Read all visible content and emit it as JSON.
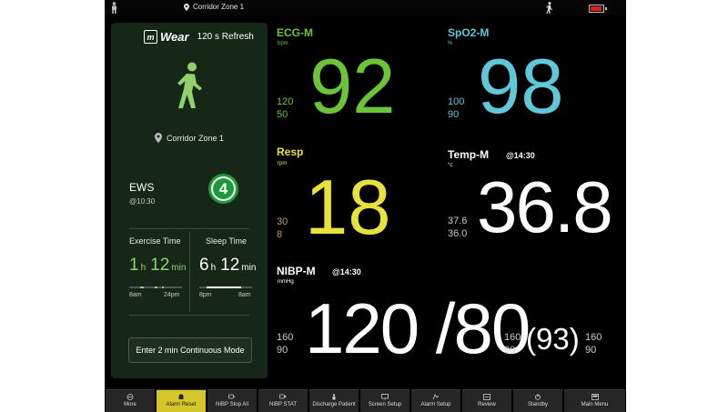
{
  "topbar": {
    "location": "Corridor Zone 1",
    "battery_color": "#e02020"
  },
  "card": {
    "brand": "Wear",
    "brand_logo_letter": "m",
    "refresh": "120 s Refresh",
    "zone": "Corridor Zone 1",
    "ews_label": "EWS",
    "ews_time": "@10:30",
    "ews_score": "4",
    "exercise": {
      "title": "Exercise Time",
      "hours": "1",
      "h": "h",
      "mins": "12",
      "min": "min",
      "tick_start": "8am",
      "tick_end": "24pm"
    },
    "sleep": {
      "title": "Sleep Time",
      "hours": "6",
      "h": "h",
      "mins": "12",
      "min": "min",
      "tick_start": "8pm",
      "tick_end": "8am"
    },
    "continuous_button": "Enter 2 min Continuous Mode"
  },
  "ecg": {
    "label": "ECG-M",
    "unit": "bpm",
    "value": "92",
    "high": "120",
    "low": "50",
    "color": "#6cc43a"
  },
  "spo2": {
    "label": "SpO2-M",
    "unit": "%",
    "value": "98",
    "high": "100",
    "low": "90",
    "color": "#5ec8d8"
  },
  "resp": {
    "label": "Resp",
    "unit": "rpm",
    "value": "18",
    "high": "30",
    "low": "8",
    "color": "#e8e23a"
  },
  "temp": {
    "label": "Temp-M",
    "time": "@14:30",
    "unit": "°c",
    "value": "36.8",
    "high": "37.6",
    "low": "36.0"
  },
  "nibp": {
    "label": "NIBP-M",
    "time": "@14:30",
    "unit": "mmHg",
    "value": "120 /80",
    "sys_high": "160",
    "sys_low": "90",
    "map_high": "160",
    "map_low": "90",
    "map": "(93)",
    "dia_high": "160",
    "dia_low": "90"
  },
  "menu": [
    {
      "label": "More",
      "icon": "more-icon"
    },
    {
      "label": "Alarm Reset",
      "icon": "alarm-reset-icon"
    },
    {
      "label": "NIBP Stop All",
      "icon": "nibp-stop-icon"
    },
    {
      "label": "NIBP STAT",
      "icon": "nibp-stat-icon"
    },
    {
      "label": "Discharge Patient",
      "icon": "discharge-icon"
    },
    {
      "label": "Screen Setup",
      "icon": "screen-setup-icon"
    },
    {
      "label": "Alarm Setup",
      "icon": "alarm-setup-icon"
    },
    {
      "label": "Review",
      "icon": "review-icon"
    },
    {
      "label": "Standby",
      "icon": "standby-icon"
    },
    {
      "label": "Main Menu",
      "icon": "main-menu-icon"
    }
  ]
}
